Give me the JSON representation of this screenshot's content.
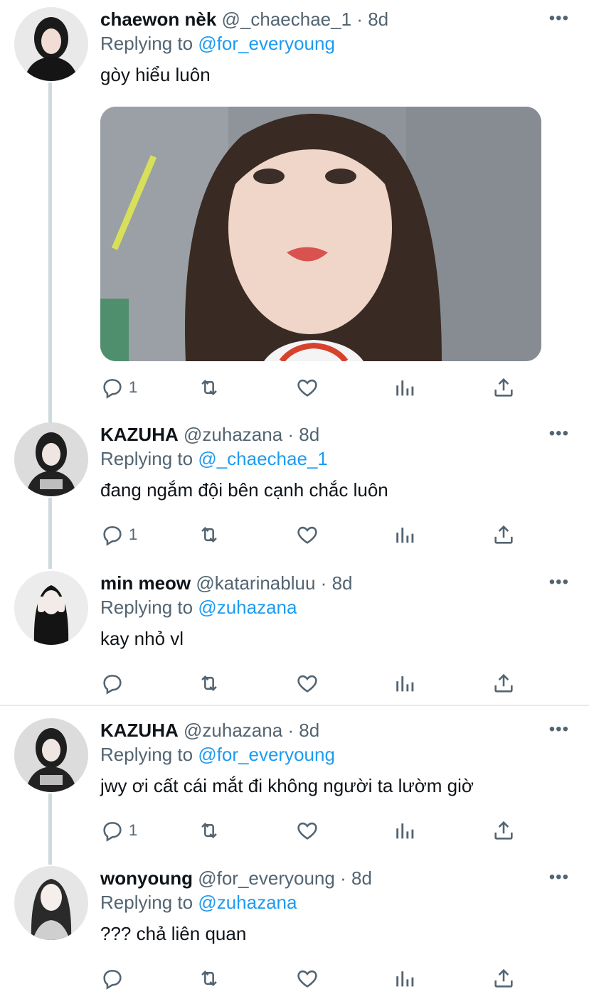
{
  "tweets": [
    {
      "name": "chaewon nèk",
      "handle": "@_chaechae_1",
      "separator": "·",
      "time": "8d",
      "replying_label": "Replying to",
      "replying_to": "@for_everyoung",
      "text": "gòy hiểu luôn",
      "reply_count": "1",
      "has_media": true
    },
    {
      "name": "KAZUHA",
      "handle": "@zuhazana",
      "separator": "·",
      "time": "8d",
      "replying_label": "Replying to",
      "replying_to": "@_chaechae_1",
      "text": "đang ngắm đội bên cạnh chắc luôn",
      "reply_count": "1"
    },
    {
      "name": "min meow",
      "handle": "@katarinabluu",
      "separator": "·",
      "time": "8d",
      "replying_label": "Replying to",
      "replying_to": "@zuhazana",
      "text": "kay nhỏ vl",
      "reply_count": ""
    },
    {
      "name": "KAZUHA",
      "handle": "@zuhazana",
      "separator": "·",
      "time": "8d",
      "replying_label": "Replying to",
      "replying_to": "@for_everyoung",
      "text": "jwy ơi cất cái mắt đi không người ta lườm giờ",
      "reply_count": "1"
    },
    {
      "name": "wonyoung",
      "handle": "@for_everyoung",
      "separator": "·",
      "time": "8d",
      "replying_label": "Replying to",
      "replying_to": "@zuhazana",
      "text": "??? chả liên quan",
      "reply_count": ""
    }
  ],
  "icons": {
    "more": "more-icon",
    "reply": "reply-icon",
    "retweet": "retweet-icon",
    "like": "heart-icon",
    "analytics": "analytics-icon",
    "share": "share-icon"
  },
  "colors": {
    "link": "#1d9bf0",
    "secondary_text": "#536471",
    "thread_line": "#cfd9de"
  }
}
